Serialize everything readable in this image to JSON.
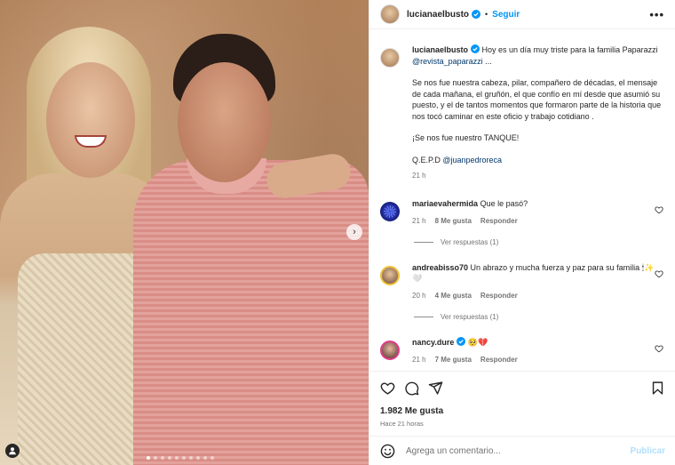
{
  "post": {
    "username": "lucianaelbusto",
    "follow_label": "Seguir",
    "more_label": "•••",
    "dot": "•",
    "caption": {
      "intro": "Hoy es un día muy triste para la familia Paparazzi",
      "mention": "@revista_paparazzi",
      "ellipsis": " ...",
      "paragraph": "Se nos fue nuestra cabeza, pilar, compañero de décadas, el mensaje de cada mañana, el gruñón, el que confío en mí desde que asumió su puesto, y el de tantos momentos que formaron parte de la historia que nos tocó caminar en este oficio y trabajo cotidiano .",
      "tanque": "¡Se nos fue nuestro TANQUE!",
      "qepd": "Q.E.P.D ",
      "qepd_mention": "@juanpedroreca",
      "time": "21 h"
    }
  },
  "comments": [
    {
      "user": "mariaevahermida",
      "text": "Que le pasó?",
      "time": "21 h",
      "likes": "8 Me gusta",
      "reply": "Responder",
      "view_replies": "Ver respuestas (1)"
    },
    {
      "user": "andreabisso70",
      "text": "Un abrazo y mucha fuerza y paz para su familia 🕯✨🤍",
      "time": "20 h",
      "likes": "4 Me gusta",
      "reply": "Responder",
      "view_replies": "Ver respuestas (1)"
    },
    {
      "user": "nancy.dure",
      "text": "🥺💔",
      "time": "21 h",
      "likes": "7 Me gusta",
      "reply": "Responder"
    }
  ],
  "footer": {
    "likes": "1.982 Me gusta",
    "ago": "Hace 21 horas",
    "comment_placeholder": "Agrega un comentario...",
    "publish": "Publicar"
  },
  "carousel": {
    "next_arrow": "›",
    "dot_count": 10,
    "active_dot": 0
  },
  "colors": {
    "accent": "#0095f6",
    "muted": "#737373",
    "verified": "#0095f6",
    "mention": "#00376b"
  },
  "icons": [
    "heart-icon",
    "comment-icon",
    "share-icon",
    "bookmark-icon",
    "emoji-icon",
    "verified-icon",
    "user-tag-icon"
  ]
}
